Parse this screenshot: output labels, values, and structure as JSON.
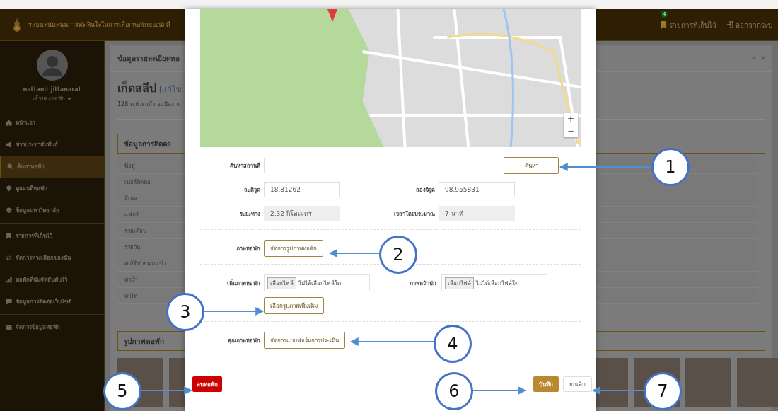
{
  "header": {
    "title": "ระบบสนับสนุนการตัดสินใจในการเลือกหอพักของนักศึ",
    "saved_count": "4",
    "saved_label": "รายการที่เก็บไว้",
    "logout_label": "ออกจากระบ"
  },
  "sidebar": {
    "user_name": "nattanit  jittanarat",
    "role": "เจ้าของหอพัก",
    "groups": [
      {
        "items": [
          {
            "label": "หน้าแรก",
            "selected": false
          },
          {
            "label": "ข่าวประชาสัมพันธ์",
            "selected": false
          },
          {
            "label": "ค้นหาหอพัก",
            "selected": true
          },
          {
            "label": "ดูแผนที่หอพัก",
            "selected": false
          },
          {
            "label": "ข้อมูลมหาวิทยาลัย",
            "selected": false
          }
        ]
      },
      {
        "items": [
          {
            "label": "รายการที่เก็บไว้",
            "selected": false
          },
          {
            "label": "จัดการทางเลือกของฉัน",
            "selected": false
          },
          {
            "label": "หอพักที่ฉันจัดอันดับไว้",
            "selected": false
          },
          {
            "label": "ข้อมูลการติดต่อเว็บไซต์",
            "selected": false
          }
        ]
      },
      {
        "items": [
          {
            "label": "จัดการข้อมูลหอพัก",
            "selected": false
          }
        ]
      }
    ]
  },
  "content": {
    "panel_title": "ข้อมูลรายละเอียดหอ",
    "dorm_name": "เก็ดสลีป",
    "edit_link": "[แก้ไข",
    "address": "128 ต.ห้วยแก้ว อ.เมือง จ.",
    "contact_title": "ข้อมูลการติดต่อ",
    "contact_rows": [
      "ที่อยู่",
      "เบอร์ติดต่อ",
      "อีเมล",
      "แฟกซ์",
      "รายเดือน",
      "รายวัน",
      "ค่าใช้จ่ายแรกเข้า",
      "ค่าน้ำ",
      "ค่าไฟ"
    ],
    "photos_title": "รูปภาพหอพัก"
  },
  "modal": {
    "map_zoom": [
      "+",
      "−"
    ],
    "search_label": "ค้นหาสถานที่",
    "search_button": "ค้นหา",
    "lat_label": "ละติจูด",
    "lat_value": "18.81262",
    "lng_label": "ลองจิจูด",
    "lng_value": "98.955831",
    "distance_label": "ระยะทาง",
    "distance_value": "2.32 กิโลเมตร",
    "time_label": "เวลาโดยประมาณ",
    "time_value": "7 นาที",
    "photos_label": "ภาพหอพัก",
    "photos_button": "จัดการรูปภาพหอพัก",
    "add_label": "เพิ่มภาพหอพัก",
    "add_file_button": "เลือกไฟล์",
    "add_file_status": "ไม่ได้เลือกไฟล์ใด",
    "cover_label": "ภาพหน้าปก",
    "cover_file_button": "เลือกไฟล์",
    "cover_file_status": "ไม่ได้เลือกไฟล์ใด",
    "more_button": "เลือกรูปภาพเพิ่มเติม",
    "quality_label": "คุณภาพหอพัก",
    "quality_button": "จัดการแบบฟอร์มการประเมิน",
    "delete_button": "ลบหอพัก",
    "save_button": "บันทึก",
    "cancel_button": "ยกเลิก"
  },
  "callouts": [
    "1",
    "2",
    "3",
    "4",
    "5",
    "6",
    "7"
  ]
}
